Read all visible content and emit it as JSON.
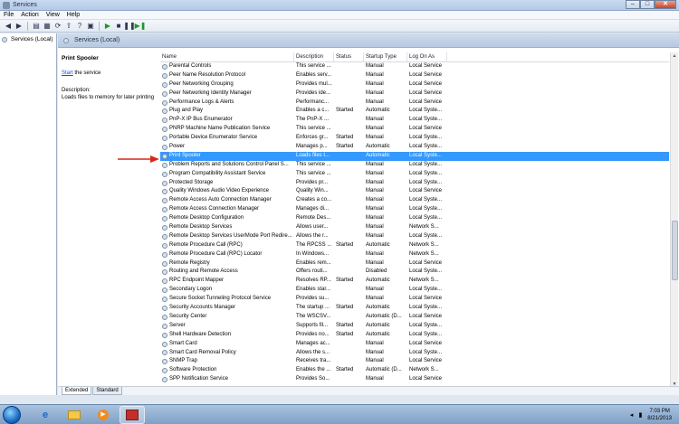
{
  "window": {
    "title": "Services"
  },
  "menu": [
    "File",
    "Action",
    "View",
    "Help"
  ],
  "tree": {
    "root": "Services (Local)"
  },
  "pane": {
    "header": "Services (Local)",
    "selected_name": "Print Spooler",
    "start_link": "Start",
    "start_suffix": " the service",
    "description_label": "Description:",
    "description_text": "Loads files to memory for later printing"
  },
  "columns": [
    "Name",
    "Description",
    "Status",
    "Startup Type",
    "Log On As"
  ],
  "rows": [
    [
      "Parental Controls",
      "This service ...",
      "",
      "Manual",
      "Local Service"
    ],
    [
      "Peer Name Resolution Protocol",
      "Enables serv...",
      "",
      "Manual",
      "Local Service"
    ],
    [
      "Peer Networking Grouping",
      "Provides mul...",
      "",
      "Manual",
      "Local Service"
    ],
    [
      "Peer Networking Identity Manager",
      "Provides ide...",
      "",
      "Manual",
      "Local Service"
    ],
    [
      "Performance Logs & Alerts",
      "Performanc...",
      "",
      "Manual",
      "Local Service"
    ],
    [
      "Plug and Play",
      "Enables a c...",
      "Started",
      "Automatic",
      "Local Syste..."
    ],
    [
      "PnP-X IP Bus Enumerator",
      "The PnP-X ...",
      "",
      "Manual",
      "Local Syste..."
    ],
    [
      "PNRP Machine Name Publication Service",
      "This service ...",
      "",
      "Manual",
      "Local Service"
    ],
    [
      "Portable Device Enumerator Service",
      "Enforces gr...",
      "Started",
      "Manual",
      "Local Syste..."
    ],
    [
      "Power",
      "Manages p...",
      "Started",
      "Automatic",
      "Local Syste..."
    ],
    [
      "Print Spooler",
      "Loads files t...",
      "",
      "Automatic",
      "Local Syste..."
    ],
    [
      "Problem Reports and Solutions Control Panel S...",
      "This service ...",
      "",
      "Manual",
      "Local Syste..."
    ],
    [
      "Program Compatibility Assistant Service",
      "This service ...",
      "",
      "Manual",
      "Local Syste..."
    ],
    [
      "Protected Storage",
      "Provides pr...",
      "",
      "Manual",
      "Local Syste..."
    ],
    [
      "Quality Windows Audio Video Experience",
      "Quality Win...",
      "",
      "Manual",
      "Local Service"
    ],
    [
      "Remote Access Auto Connection Manager",
      "Creates a co...",
      "",
      "Manual",
      "Local Syste..."
    ],
    [
      "Remote Access Connection Manager",
      "Manages di...",
      "",
      "Manual",
      "Local Syste..."
    ],
    [
      "Remote Desktop Configuration",
      "Remote Des...",
      "",
      "Manual",
      "Local Syste..."
    ],
    [
      "Remote Desktop Services",
      "Allows user...",
      "",
      "Manual",
      "Network S..."
    ],
    [
      "Remote Desktop Services UserMode Port Redire...",
      "Allows the r...",
      "",
      "Manual",
      "Local Syste..."
    ],
    [
      "Remote Procedure Call (RPC)",
      "The RPCSS ...",
      "Started",
      "Automatic",
      "Network S..."
    ],
    [
      "Remote Procedure Call (RPC) Locator",
      "In Windows...",
      "",
      "Manual",
      "Network S..."
    ],
    [
      "Remote Registry",
      "Enables rem...",
      "",
      "Manual",
      "Local Service"
    ],
    [
      "Routing and Remote Access",
      "Offers routi...",
      "",
      "Disabled",
      "Local Syste..."
    ],
    [
      "RPC Endpoint Mapper",
      "Resolves RP...",
      "Started",
      "Automatic",
      "Network S..."
    ],
    [
      "Secondary Logon",
      "Enables star...",
      "",
      "Manual",
      "Local Syste..."
    ],
    [
      "Secure Socket Tunneling Protocol Service",
      "Provides su...",
      "",
      "Manual",
      "Local Service"
    ],
    [
      "Security Accounts Manager",
      "The startup ...",
      "Started",
      "Automatic",
      "Local Syste..."
    ],
    [
      "Security Center",
      "The WSCSV...",
      "",
      "Automatic (D...",
      "Local Service"
    ],
    [
      "Server",
      "Supports fil...",
      "Started",
      "Automatic",
      "Local Syste..."
    ],
    [
      "Shell Hardware Detection",
      "Provides no...",
      "Started",
      "Automatic",
      "Local Syste..."
    ],
    [
      "Smart Card",
      "Manages ac...",
      "",
      "Manual",
      "Local Service"
    ],
    [
      "Smart Card Removal Policy",
      "Allows the s...",
      "",
      "Manual",
      "Local Syste..."
    ],
    [
      "SNMP Trap",
      "Receives tra...",
      "",
      "Manual",
      "Local Service"
    ],
    [
      "Software Protection",
      "Enables the ...",
      "Started",
      "Automatic (D...",
      "Network S..."
    ],
    [
      "SPP Notification Service",
      "Provides So...",
      "",
      "Manual",
      "Local Service"
    ]
  ],
  "selected_index": 10,
  "tabs": [
    "Extended",
    "Standard"
  ],
  "taskbar": {
    "time": "7:03 PM",
    "date": "8/21/2013"
  },
  "colors": {
    "selection": "#3399ff",
    "annotation_arrow": "#d9261c"
  }
}
